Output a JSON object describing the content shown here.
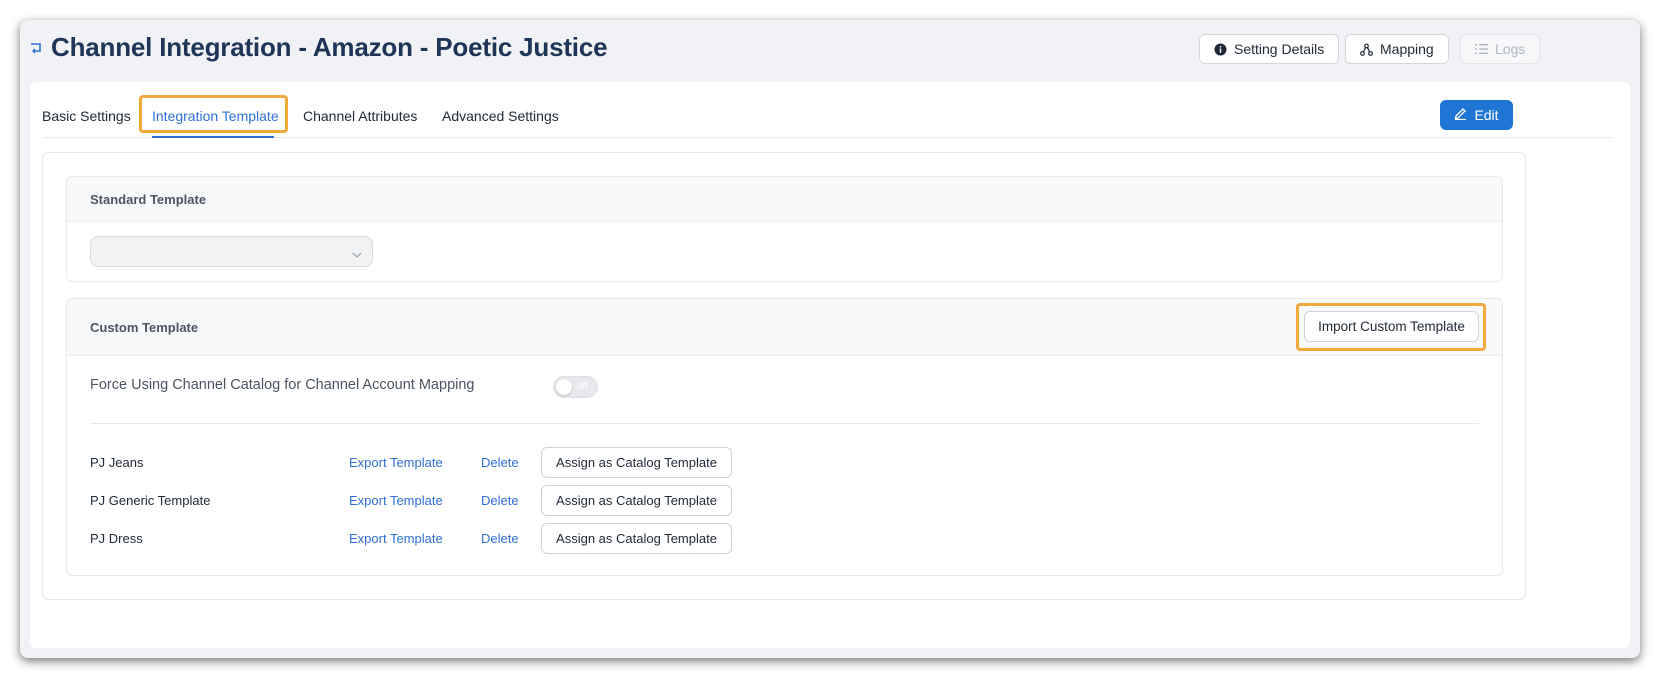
{
  "header": {
    "title": "Channel Integration - Amazon - Poetic Justice",
    "buttons": {
      "setting_details": "Setting Details",
      "mapping": "Mapping",
      "logs": "Logs"
    }
  },
  "tabs": [
    {
      "label": "Basic Settings",
      "active": false
    },
    {
      "label": "Integration Template",
      "active": true
    },
    {
      "label": "Channel Attributes",
      "active": false
    },
    {
      "label": "Advanced Settings",
      "active": false
    }
  ],
  "edit_label": "Edit",
  "standard_template": {
    "title": "Standard Template",
    "select_value": ""
  },
  "custom_template": {
    "title": "Custom Template",
    "import_label": "Import Custom Template",
    "force_label": "Force Using Channel Catalog for Channel Account Mapping",
    "toggle_text": "off",
    "templates": [
      {
        "name": "PJ Jeans",
        "export": "Export Template",
        "delete": "Delete",
        "assign": "Assign as Catalog Template"
      },
      {
        "name": "PJ Generic Template",
        "export": "Export Template",
        "delete": "Delete",
        "assign": "Assign as Catalog Template"
      },
      {
        "name": "PJ Dress",
        "export": "Export Template",
        "delete": "Delete",
        "assign": "Assign as Catalog Template"
      }
    ]
  },
  "colors": {
    "accent": "#2f6fd6",
    "primary_button": "#1f75d4",
    "highlight": "#f0a93a",
    "title": "#1e3557"
  },
  "icons": {
    "back": "back-arrow-icon",
    "setting_details": "info-circle-icon",
    "mapping": "network-icon",
    "logs": "list-icon",
    "edit": "pencil-icon",
    "select": "chevron-down-icon"
  }
}
